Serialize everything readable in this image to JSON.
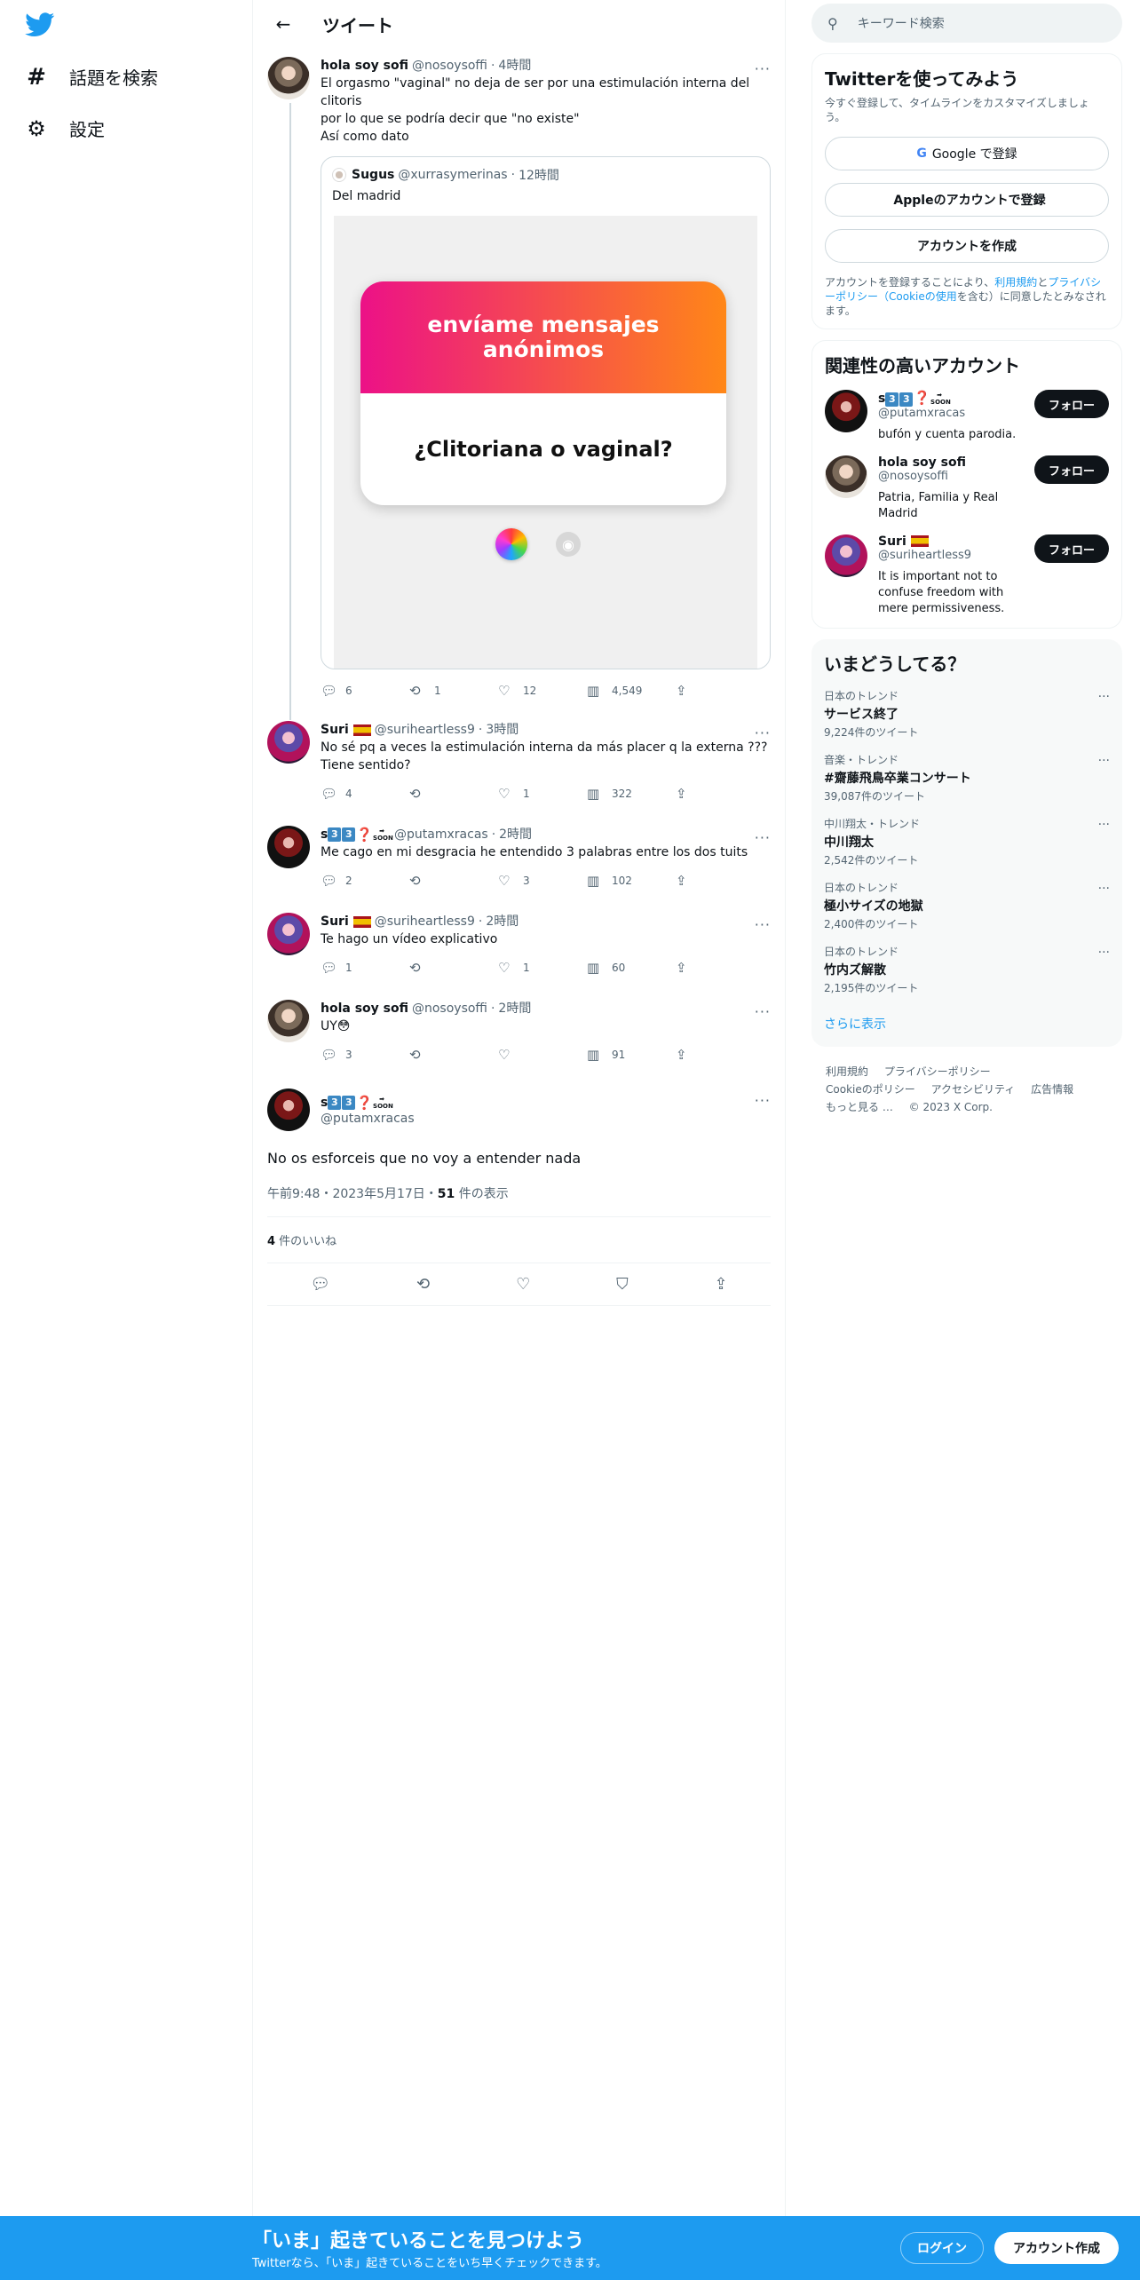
{
  "nav": {
    "items": [
      {
        "icon": "hash-icon",
        "glyph": "#",
        "label": "話題を検索"
      },
      {
        "icon": "gear-icon",
        "glyph": "⚙",
        "label": "設定"
      }
    ]
  },
  "header": {
    "title": "ツイート",
    "back": "←"
  },
  "tweets": [
    {
      "name": "hola soy sofi",
      "handle": "@nosoysoffi",
      "time": "4時間",
      "text": "El orgasmo \"vaginal\" no deja de ser por una estimulación interna del clitoris\npor lo que se podría decir que \"no existe\"\nAsí como dato",
      "quote": {
        "name": "Sugus",
        "handle": "@xurrasymerinas",
        "time": "12時間",
        "text": "Del madrid",
        "card_top": "envíame mensajes anónimos",
        "card_bottom": "¿Clitoriana o vaginal?"
      },
      "replies": "6",
      "retweets": "1",
      "likes": "12",
      "views": "4,549"
    },
    {
      "name": "Suri",
      "handle": "@suriheartless9",
      "time": "3時間",
      "text": "No sé pq a veces la estimulación interna da más placer q la externa ???\nTiene sentido?",
      "replies": "4",
      "retweets": "",
      "likes": "1",
      "views": "322"
    },
    {
      "name": "s",
      "handle": "@putamxracas",
      "time": "2時間",
      "text": "Me cago en mi desgracia he entendido 3 palabras entre los dos tuits",
      "replies": "2",
      "retweets": "",
      "likes": "3",
      "views": "102"
    },
    {
      "name": "Suri",
      "handle": "@suriheartless9",
      "time": "2時間",
      "text": "Te hago un vídeo explicativo",
      "replies": "1",
      "retweets": "",
      "likes": "1",
      "views": "60"
    },
    {
      "name": "hola soy sofi",
      "handle": "@nosoysoffi",
      "time": "2時間",
      "text": "UY😳",
      "replies": "3",
      "retweets": "",
      "likes": "",
      "views": "91"
    }
  ],
  "focus": {
    "name": "s",
    "handle": "@putamxracas",
    "text": "No os esforceis que no voy a entender nada",
    "time": "午前9:48・2023年5月17日・",
    "views_count": "51",
    "views_label": " 件の表示",
    "likes_count": "4",
    "likes_label": " 件のいいね"
  },
  "emoji": {
    "key3": "3",
    "soon": "SOON",
    "arrow": "➡",
    "question": "❓"
  },
  "search": {
    "placeholder": "キーワード検索"
  },
  "signup_box": {
    "title": "Twitterを使ってみよう",
    "subtitle": "今すぐ登録して、タイムラインをカスタマイズしましょう。",
    "google": "Google で登録",
    "apple": "Appleのアカウントで登録",
    "create": "アカウントを作成",
    "terms_pre": "アカウントを登録することにより、",
    "terms_link1": "利用規約",
    "terms_mid": "と",
    "terms_link2": "プライバシーポリシー（Cookieの使用",
    "terms_post": "を含む）に同意したとみなされます。"
  },
  "related": {
    "title": "関連性の高いアカウント",
    "follow": "フォロー",
    "accounts": [
      {
        "name": "s",
        "handle": "@putamxracas",
        "bio": "bufón y cuenta parodia."
      },
      {
        "name": "hola soy sofi",
        "handle": "@nosoysoffi",
        "bio": "Patria, Familia y Real Madrid"
      },
      {
        "name": "Suri",
        "handle": "@suriheartless9",
        "bio": "It is important not to confuse freedom with mere permissiveness."
      }
    ]
  },
  "trends": {
    "title": "いまどうしてる？",
    "items": [
      {
        "meta": "日本のトレンド",
        "name": "サービス終了",
        "count": "9,224件のツイート"
      },
      {
        "meta": "音楽・トレンド",
        "name": "#齋藤飛鳥卒業コンサート",
        "count": "39,087件のツイート"
      },
      {
        "meta": "中川翔太・トレンド",
        "name": "中川翔太",
        "count": "2,542件のツイート"
      },
      {
        "meta": "日本のトレンド",
        "name": "極小サイズの地獄",
        "count": "2,400件のツイート"
      },
      {
        "meta": "日本のトレンド",
        "name": "竹内ズ解散",
        "count": "2,195件のツイート"
      }
    ],
    "show_more": "さらに表示"
  },
  "footer": {
    "links": [
      "利用規約",
      "プライバシーポリシー",
      "Cookieのポリシー",
      "アクセシビリティ",
      "広告情報",
      "もっと見る …",
      "© 2023 X Corp."
    ]
  },
  "bottom": {
    "title": "「いま」起きていることを見つけよう",
    "subtitle": "Twitterなら、「いま」起きていることをいち早くチェックできます。",
    "login": "ログイン",
    "signup": "アカウント作成"
  },
  "colors": {
    "accent": "#1d9bf0",
    "text": "#0f1419",
    "muted": "#536471"
  }
}
